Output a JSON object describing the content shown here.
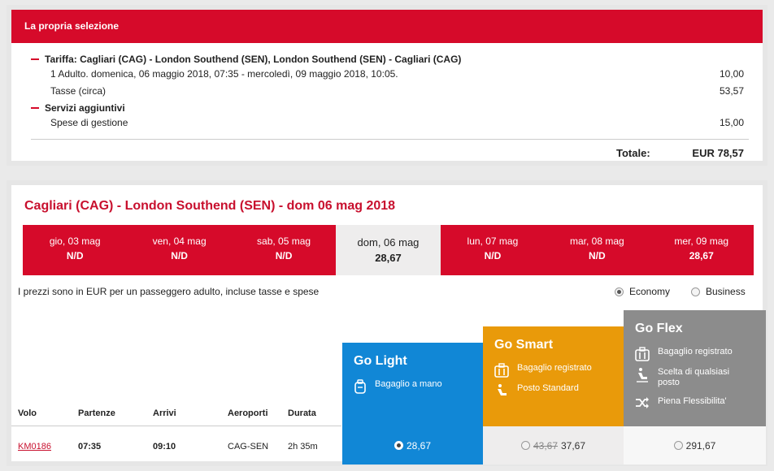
{
  "summary": {
    "title": "La propria selezione",
    "fare_label": "Tariffa: Cagliari (CAG) - London Southend (SEN), London Southend (SEN) - Cagliari (CAG)",
    "passenger_line": "1 Adulto. domenica, 06 maggio 2018, 07:35 - mercoledì, 09 maggio 2018, 10:05.",
    "passenger_value": "10,00",
    "taxes_label": "Tasse (circa)",
    "taxes_value": "53,57",
    "services_label": "Servizi aggiuntivi",
    "fees_label": "Spese di gestione",
    "fees_value": "15,00",
    "total_label": "Totale:",
    "total_value": "EUR 78,57"
  },
  "flights": {
    "route_title": "Cagliari (CAG) - London Southend (SEN) - dom 06 mag 2018",
    "dates": [
      {
        "name": "gio, 03 mag",
        "price": "N/D",
        "selected": false
      },
      {
        "name": "ven, 04 mag",
        "price": "N/D",
        "selected": false
      },
      {
        "name": "sab, 05 mag",
        "price": "N/D",
        "selected": false
      },
      {
        "name": "dom, 06 mag",
        "price": "28,67",
        "selected": true
      },
      {
        "name": "lun, 07 mag",
        "price": "N/D",
        "selected": false
      },
      {
        "name": "mar, 08 mag",
        "price": "N/D",
        "selected": false
      },
      {
        "name": "mer, 09 mag",
        "price": "28,67",
        "selected": false
      }
    ],
    "price_note": "I prezzi sono in EUR per un passeggero adulto, incluse tasse e spese",
    "class_options": {
      "economy": "Economy",
      "business": "Business",
      "selected": "economy"
    },
    "columns": {
      "flight": "Volo",
      "departure": "Partenze",
      "arrival": "Arrivi",
      "airports": "Aeroporti",
      "duration": "Durata"
    },
    "fares": {
      "light": {
        "name": "Go Light",
        "features": [
          "Bagaglio a mano"
        ]
      },
      "smart": {
        "name": "Go Smart",
        "features": [
          "Bagaglio registrato",
          "Posto Standard"
        ]
      },
      "flex": {
        "name": "Go Flex",
        "features": [
          "Bagaglio registrato",
          "Scelta di qualsiasi posto",
          "Piena Flessibilita'"
        ]
      }
    },
    "row": {
      "flight": "KM0186",
      "departure": "07:35",
      "arrival": "09:10",
      "airports": "CAG-SEN",
      "duration": "2h 35m",
      "price_light": "28,67",
      "price_smart_old": "43,67",
      "price_smart": "37,67",
      "price_flex": "291,67"
    }
  },
  "colors": {
    "brand_red": "#d60a2a",
    "light_blue": "#1187d6",
    "smart_orange": "#e99a0a",
    "flex_grey": "#8c8c8c"
  }
}
